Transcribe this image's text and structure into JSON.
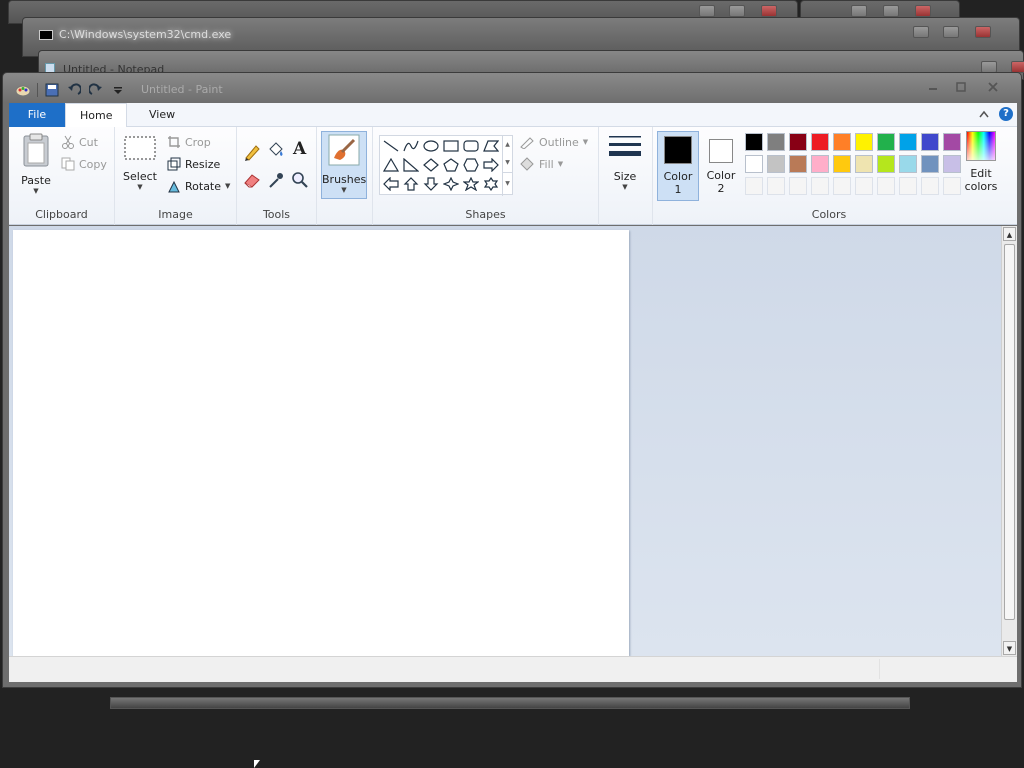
{
  "background_windows": {
    "cmd_title": "C:\\Windows\\system32\\cmd.exe",
    "notepad_title": "Untitled - Notepad"
  },
  "window": {
    "title": "Untitled - Paint",
    "minimize_icon": "minimize-icon",
    "maximize_icon": "maximize-icon",
    "close_icon": "close-icon"
  },
  "tabs": {
    "file": "File",
    "home": "Home",
    "view": "View"
  },
  "clipboard": {
    "paste": "Paste",
    "cut": "Cut",
    "copy": "Copy",
    "label": "Clipboard"
  },
  "image": {
    "select": "Select",
    "crop": "Crop",
    "resize": "Resize",
    "rotate": "Rotate",
    "label": "Image"
  },
  "tools": {
    "label": "Tools",
    "text_glyph": "A"
  },
  "brushes": {
    "label": "Brushes"
  },
  "shapes": {
    "outline": "Outline",
    "fill": "Fill",
    "label": "Shapes"
  },
  "size": {
    "label": "Size"
  },
  "colors": {
    "color1_label": "Color",
    "color1_num": "1",
    "color2_label": "Color",
    "color2_num": "2",
    "edit_label": "Edit",
    "edit_label2": "colors",
    "label": "Colors",
    "color1": "#000000",
    "color2": "#ffffff",
    "palette_row1": [
      "#000000",
      "#7f7f7f",
      "#880015",
      "#ed1c24",
      "#ff7f27",
      "#fff200",
      "#22b14c",
      "#00a2e8",
      "#3f48cc",
      "#a349a4"
    ],
    "palette_row2": [
      "#ffffff",
      "#c3c3c3",
      "#b97a57",
      "#ffaec9",
      "#ffc90e",
      "#efe4b0",
      "#b5e61d",
      "#99d9ea",
      "#7092be",
      "#c8bfe7"
    ],
    "palette_row3": [
      "#f5f5f5",
      "#f5f5f5",
      "#f5f5f5",
      "#f5f5f5",
      "#f5f5f5",
      "#f5f5f5",
      "#f5f5f5",
      "#f5f5f5",
      "#f5f5f5",
      "#f5f5f5"
    ]
  }
}
